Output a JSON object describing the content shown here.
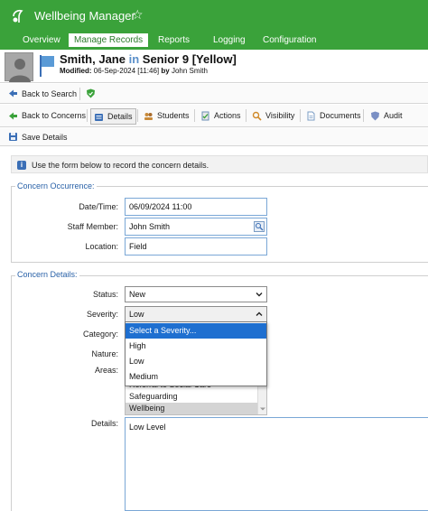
{
  "app": {
    "title": "Wellbeing Manager"
  },
  "nav": [
    "Overview",
    "Manage Records",
    "Reports",
    "Logging",
    "Configuration"
  ],
  "student": {
    "name": "Smith, Jane",
    "in_word": "in",
    "group": "Senior 9 [Yellow]",
    "modified_label": "Modified:",
    "modified_value": "06-Sep-2024 [11:46]",
    "by_word": "by",
    "modified_by": "John Smith"
  },
  "toolbar1": {
    "back_to_search": "Back to Search"
  },
  "toolbar2": {
    "back_to_concerns": "Back to Concerns",
    "details": "Details",
    "students": "Students",
    "actions": "Actions",
    "visibility": "Visibility",
    "documents": "Documents",
    "audit": "Audit"
  },
  "toolbar3": {
    "save_details": "Save Details"
  },
  "info": {
    "text": "Use the form below to record the concern details."
  },
  "occurrence": {
    "legend": "Concern Occurrence:",
    "datetime_label": "Date/Time:",
    "datetime_value": "06/09/2024 11:00",
    "staff_label": "Staff Member:",
    "staff_value": "John Smith",
    "location_label": "Location:",
    "location_value": "Field"
  },
  "details": {
    "legend": "Concern Details:",
    "status_label": "Status:",
    "status_value": "New",
    "severity_label": "Severity:",
    "severity_value": "Low",
    "category_label": "Category:",
    "nature_label": "Nature:",
    "areas_label": "Areas:",
    "details_label": "Details:",
    "details_value": "Low Level"
  },
  "severity_options": [
    "Select a Severity...",
    "High",
    "Low",
    "Medium"
  ],
  "areas_items": [
    "Referral to Social Care",
    "Safeguarding",
    "Wellbeing"
  ],
  "colors": {
    "brand_green": "#3aa23a",
    "legend_blue": "#2a62a8",
    "highlight_blue": "#1e6fd0"
  }
}
